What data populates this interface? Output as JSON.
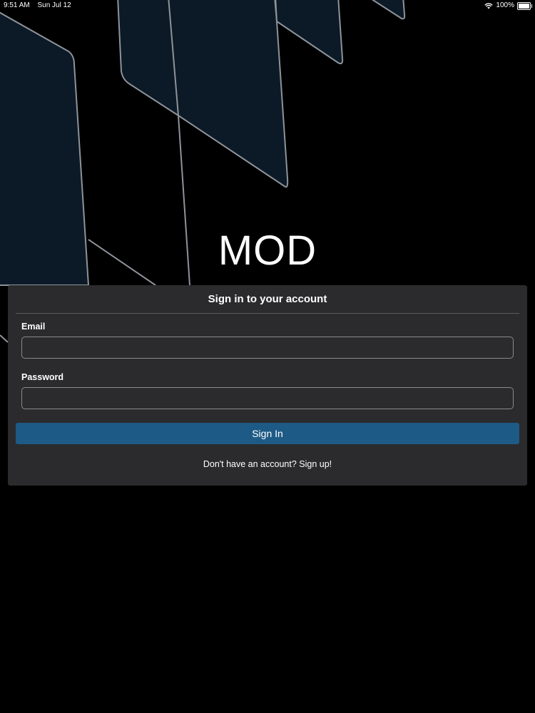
{
  "status_bar": {
    "time": "9:51 AM",
    "date": "Sun Jul 12",
    "battery": "100%",
    "wifi_icon": "wifi-icon",
    "battery_icon": "battery-icon"
  },
  "brand": {
    "title": "MOD"
  },
  "login_card": {
    "title": "Sign in to your account",
    "email_label": "Email",
    "email_value": "",
    "password_label": "Password",
    "password_value": "",
    "submit_label": "Sign In",
    "signup_text": "Don't have an account? Sign up!"
  },
  "colors": {
    "background": "#000000",
    "card": "#2b2b2d",
    "accent": "#1e5a86",
    "panel_fill": "#0b1a26",
    "panel_stroke": "#8a8f96"
  }
}
